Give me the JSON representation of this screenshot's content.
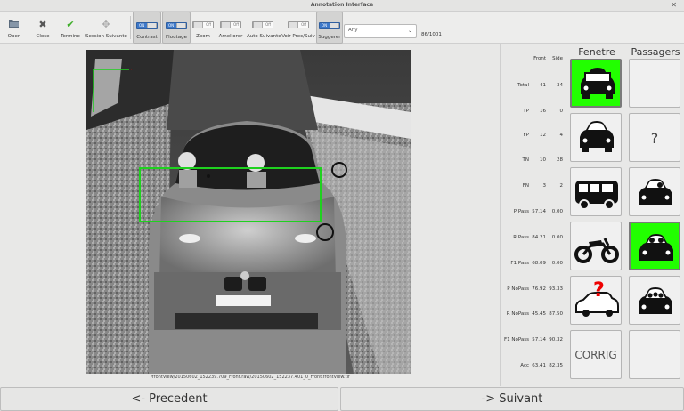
{
  "window": {
    "title": "Annotation Interface",
    "close_glyph": "✕"
  },
  "toolbar": {
    "open": "Open",
    "close": "Close",
    "termine": "Termine",
    "session_suivante": "Session Suivante",
    "contrast": "Contrast",
    "floutage": "Floutage",
    "zoom": "Zoom",
    "ameliorer": "Ameliorer",
    "auto_suivante": "Auto Suivante",
    "voir_prec_suiv": "Voir Prec/Suiv",
    "suggerer": "Suggerer",
    "state_on": "ON",
    "state_off": "Off",
    "select_value": "Any",
    "counter": "86/1001"
  },
  "viewer": {
    "file_path": "/frontView/20150602_152239.709_Front.raw/20150602_152237.401_0_Front.frontView.tif"
  },
  "stats": {
    "col_front": "Front",
    "col_side": "Side",
    "rows": [
      {
        "label": "Total",
        "front": "41",
        "side": "34"
      },
      {
        "label": "TP",
        "front": "16",
        "side": "0"
      },
      {
        "label": "FP",
        "front": "12",
        "side": "4"
      },
      {
        "label": "TN",
        "front": "10",
        "side": "28"
      },
      {
        "label": "FN",
        "front": "3",
        "side": "2"
      },
      {
        "label": "P Pass",
        "front": "57.14",
        "side": "0.00"
      },
      {
        "label": "R Pass",
        "front": "84.21",
        "side": "0.00"
      },
      {
        "label": "F1 Pass",
        "front": "68.09",
        "side": "0.00"
      },
      {
        "label": "P NoPass",
        "front": "76.92",
        "side": "93.33"
      },
      {
        "label": "R NoPass",
        "front": "45.45",
        "side": "87.50"
      },
      {
        "label": "F1 NoPass",
        "front": "57.14",
        "side": "90.32"
      },
      {
        "label": "Acc",
        "front": "63.41",
        "side": "82.35"
      }
    ]
  },
  "fenetre": {
    "title": "Fenetre",
    "corrig_label": "CORRIG",
    "tiles": [
      "car-window-icon",
      "car-front-icon",
      "van-icon",
      "motorcycle-icon",
      "unknown-car-icon",
      "corrig-button"
    ]
  },
  "passagers": {
    "title": "Passagers",
    "unknown_label": "?",
    "tiles": [
      "blank",
      "unknown",
      "one-passenger-icon",
      "two-passengers-icon",
      "three-passengers-icon",
      "blank"
    ]
  },
  "colors": {
    "selected_tile": "#22ff00",
    "toggle_on": "#3d78c9",
    "detection_box": "#1fd11f"
  },
  "nav": {
    "prev": "<- Precedent",
    "next": "-> Suivant"
  }
}
